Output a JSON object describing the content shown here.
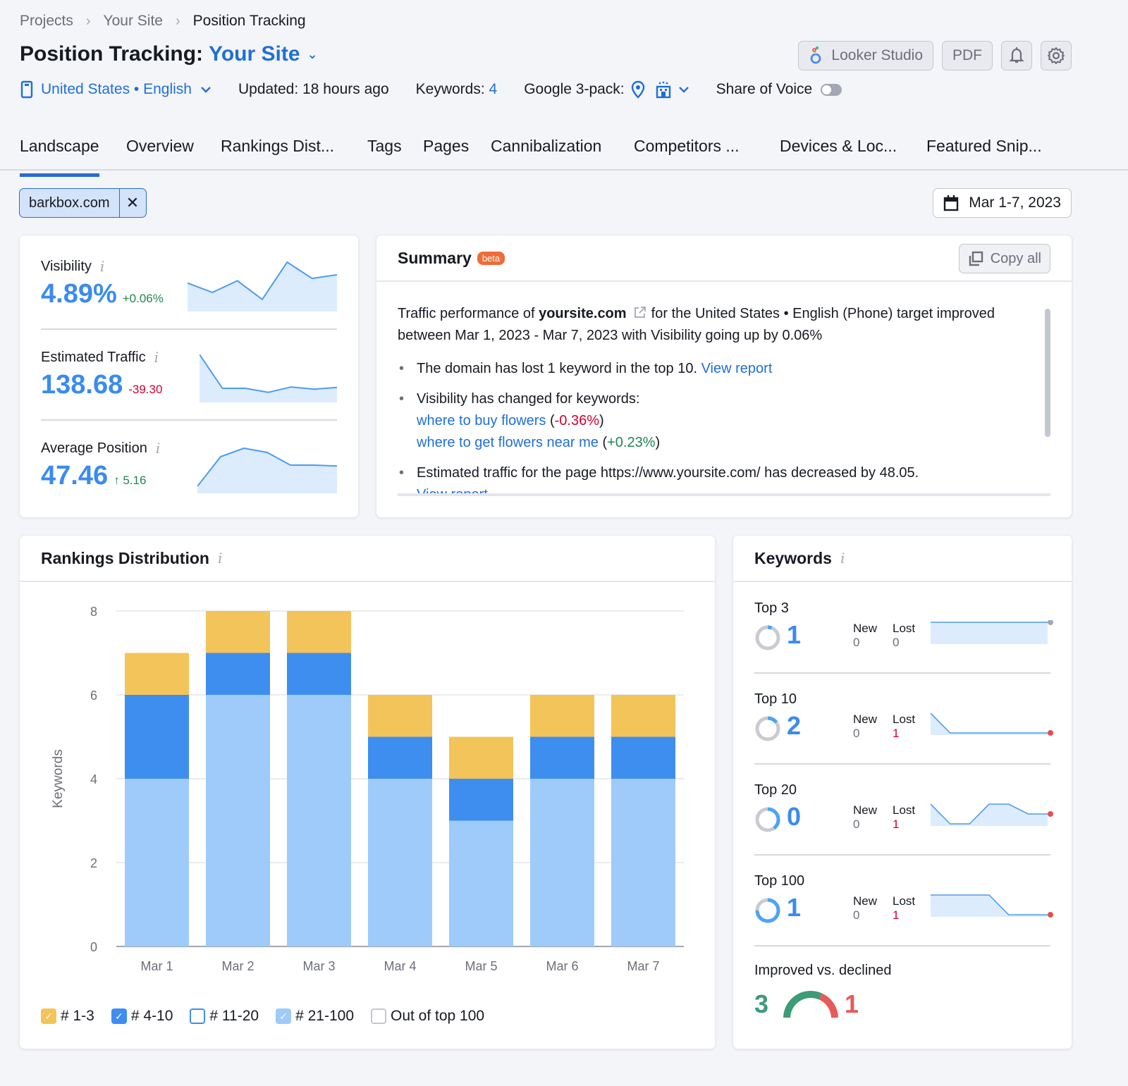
{
  "breadcrumb": [
    "Projects",
    "Your Site",
    "Position Tracking"
  ],
  "header": {
    "title_prefix": "Position Tracking:",
    "title_site": "Your Site",
    "location": "United States • English",
    "updated": "Updated: 18 hours ago",
    "keywords_label": "Keywords:",
    "keywords_count": "4",
    "google_3pack_label": "Google 3-pack:",
    "share_of_voice_label": "Share of Voice",
    "share_of_voice_on": false
  },
  "actions": {
    "looker_label": "Looker Studio",
    "pdf_label": "PDF"
  },
  "tabs": [
    "Landscape",
    "Overview",
    "Rankings Dist...",
    "Tags",
    "Pages",
    "Cannibalization",
    "Competitors ...",
    "Devices & Loc...",
    "Featured Snip..."
  ],
  "active_tab": "Landscape",
  "filter_chip": "barkbox.com",
  "date_range": "Mar 1-7, 2023",
  "metrics": [
    {
      "label": "Visibility",
      "value": "4.89%",
      "delta": "+0.06%",
      "trend": "up",
      "spark": [
        0.55,
        0.35,
        0.6,
        0.2,
        1.0,
        0.65,
        0.73
      ]
    },
    {
      "label": "Estimated Traffic",
      "value": "138.68",
      "delta": "-39.30",
      "trend": "down",
      "spark": [
        1.0,
        0.25,
        0.25,
        0.16,
        0.28,
        0.23,
        0.27
      ]
    },
    {
      "label": "Average Position",
      "value": "47.46",
      "delta": "↑ 5.16",
      "trend": "up",
      "spark": [
        0.1,
        0.8,
        1.0,
        0.9,
        0.6,
        0.6,
        0.58
      ]
    }
  ],
  "summary": {
    "title": "Summary",
    "badge": "beta",
    "copy_label": "Copy all",
    "intro_pre": "Traffic performance of ",
    "intro_domain": "yoursite.com",
    "intro_post": " for the United States • English (Phone) target improved between Mar 1, 2023 - Mar 7, 2023 with Visibility going up by 0.06%",
    "bullet1_text": "The domain has lost 1 keyword in the top 10. ",
    "bullet1_link": "View report",
    "bullet2_text": "Visibility has changed for keywords:",
    "kw1": "where to buy flowers",
    "kw1_change": "-0.36%",
    "kw2": "where to get flowers near me",
    "kw2_change": "+0.23%",
    "bullet3_text": "Estimated traffic for the page https://www.yoursite.com/ has decreased by 48.05.",
    "bullet3_link": "View report"
  },
  "rankings": {
    "title": "Rankings Distribution"
  },
  "chart_data": {
    "type": "bar",
    "stacked": true,
    "title": "Rankings Distribution",
    "xlabel": "",
    "ylabel": "Keywords",
    "ylim": [
      0,
      8
    ],
    "yticks": [
      0,
      2,
      4,
      6,
      8
    ],
    "grid": true,
    "legend_position": "bottom-left",
    "categories": [
      "Mar 1",
      "Mar 2",
      "Mar 3",
      "Mar 4",
      "Mar 5",
      "Mar 6",
      "Mar 7"
    ],
    "series": [
      {
        "name": "# 21-100",
        "color": "#9ecbf9",
        "values": [
          4,
          6,
          6,
          4,
          3,
          4,
          4
        ]
      },
      {
        "name": "# 11-20",
        "color": "#ffffff",
        "values": [
          0,
          0,
          0,
          0,
          0,
          0,
          0
        ]
      },
      {
        "name": "# 4-10",
        "color": "#3e8ef0",
        "values": [
          2,
          1,
          1,
          1,
          1,
          1,
          1
        ]
      },
      {
        "name": "# 1-3",
        "color": "#f3c45a",
        "values": [
          1,
          1,
          1,
          1,
          1,
          1,
          1
        ]
      }
    ]
  },
  "legend": [
    {
      "label": "# 1-3",
      "color": "#f3c45a",
      "checked": true
    },
    {
      "label": "# 4-10",
      "color": "#3e8ef0",
      "checked": true
    },
    {
      "label": "# 11-20",
      "color": "#3e8ef0",
      "checked": false
    },
    {
      "label": "# 21-100",
      "color": "#9ecbf9",
      "checked": true
    },
    {
      "label": "Out of top 100",
      "color": "#c4c7cf",
      "checked": false
    }
  ],
  "keywords": {
    "title": "Keywords",
    "new_label": "New",
    "lost_label": "Lost",
    "rows": [
      {
        "label": "Top 3",
        "value": "1",
        "share": 0.06,
        "new": "0",
        "lost": "0",
        "spark": [
          1,
          1,
          1,
          1,
          1,
          1,
          1
        ]
      },
      {
        "label": "Top 10",
        "value": "2",
        "share": 0.15,
        "new": "0",
        "lost": "1",
        "spark": [
          1,
          0,
          0,
          0,
          0,
          0,
          0
        ]
      },
      {
        "label": "Top 20",
        "value": "0",
        "share": 0.4,
        "new": "0",
        "lost": "1",
        "spark": [
          1,
          0,
          0,
          1,
          1,
          0.5,
          0.5
        ]
      },
      {
        "label": "Top 100",
        "value": "1",
        "share": 0.75,
        "new": "0",
        "lost": "1",
        "spark": [
          1,
          1,
          1,
          1,
          0,
          0,
          0
        ]
      }
    ],
    "improved_label": "Improved vs. declined",
    "improved": "3",
    "declined": "1"
  }
}
